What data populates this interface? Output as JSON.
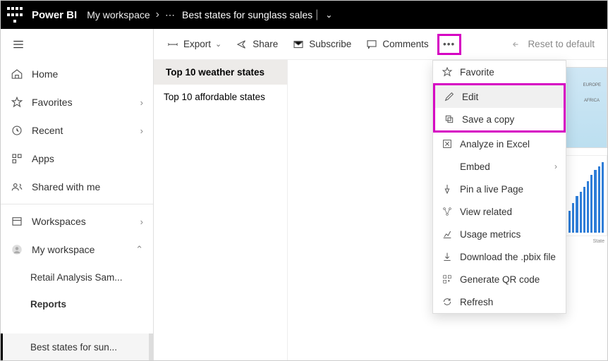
{
  "header": {
    "brand": "Power BI",
    "workspace": "My workspace",
    "ellipsis": "⋯",
    "title": "Best states for sunglass sales"
  },
  "sidebar": {
    "home": "Home",
    "favorites": "Favorites",
    "recent": "Recent",
    "apps": "Apps",
    "shared": "Shared with me",
    "workspaces": "Workspaces",
    "my_workspace": "My workspace",
    "retail": "Retail Analysis Sam...",
    "reports": "Reports",
    "current": "Best states for sun..."
  },
  "toolbar": {
    "export": "Export",
    "share": "Share",
    "subscribe": "Subscribe",
    "comments": "Comments",
    "reset": "Reset to default"
  },
  "pages": {
    "p1": "Top 10 weather states",
    "p2": "Top 10 affordable states"
  },
  "menu": {
    "favorite": "Favorite",
    "edit": "Edit",
    "save_copy": "Save a copy",
    "analyze": "Analyze in Excel",
    "embed": "Embed",
    "pin": "Pin a live Page",
    "related": "View related",
    "usage": "Usage metrics",
    "download": "Download the .pbix file",
    "qr": "Generate QR code",
    "refresh": "Refresh"
  },
  "chart_label": "State"
}
